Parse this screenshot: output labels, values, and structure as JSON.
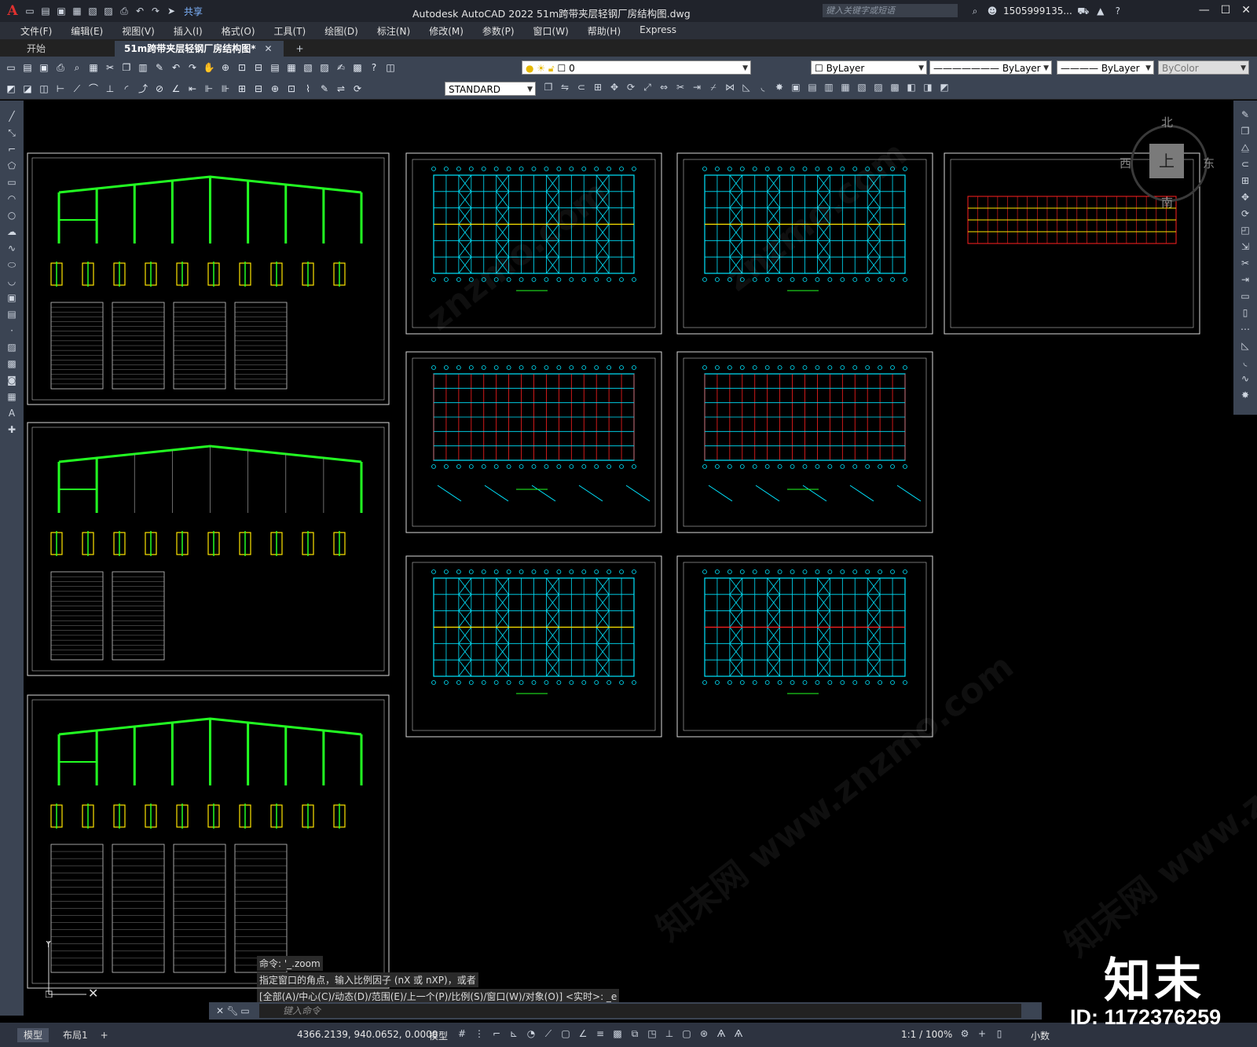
{
  "app": {
    "window_title": "Autodesk AutoCAD 2022    51m跨带夹层轻钢厂房结构图.dwg",
    "share_label": "共享",
    "search_placeholder": "键入关键字或短语",
    "username": "1505999135..."
  },
  "menu": [
    "文件(F)",
    "编辑(E)",
    "视图(V)",
    "插入(I)",
    "格式(O)",
    "工具(T)",
    "绘图(D)",
    "标注(N)",
    "修改(M)",
    "参数(P)",
    "窗口(W)",
    "帮助(H)",
    "Express"
  ],
  "tabs": [
    {
      "label": "开始",
      "active": false
    },
    {
      "label": "51m跨带夹层轻钢厂房结构图*",
      "active": true
    }
  ],
  "properties": {
    "layer": "0",
    "color": "ByLayer",
    "linetype": "ByLayer",
    "lineweight": "ByLayer",
    "plotstyle": "ByColor",
    "textstyle": "STANDARD"
  },
  "viewcube": {
    "north": "北",
    "south": "南",
    "east": "东",
    "west": "西",
    "face": "上"
  },
  "command": {
    "history": [
      "命令: '_.zoom",
      "指定窗口的角点，输入比例因子 (nX 或 nXP)，或者",
      "[全部(A)/中心(C)/动态(D)/范围(E)/上一个(P)/比例(S)/窗口(W)/对象(O)] <实时>: _e"
    ],
    "placeholder": "键入命令"
  },
  "status": {
    "layout_tabs": [
      "模型",
      "布局1"
    ],
    "coordinates": "4366.2139, 940.0652, 0.0000",
    "mode": "模型",
    "scale": "1:1 / 100%",
    "units": "小数"
  },
  "branding": {
    "name": "知末",
    "id": "ID: 1172376259"
  },
  "colors": {
    "accent_red": "#e0312f",
    "drawing_green": "#22ff22",
    "drawing_cyan": "#00e5ff",
    "drawing_red": "#ff2020",
    "drawing_yellow": "#ffe600"
  }
}
